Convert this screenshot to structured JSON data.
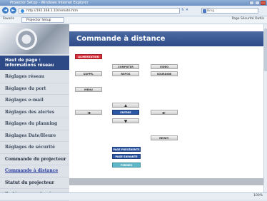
{
  "browser": {
    "title": "Projector Setup - Windows Internet Explorer",
    "address": "http://192.168.1.10/remote.htm",
    "search_placeholder": "Bing",
    "favorites_label": "Favoris",
    "tab_label": "Projector Setup",
    "tools_label": "Page  Sécurité  Outils",
    "status_zoom": "100%"
  },
  "sidebar": {
    "header": "Haut de page : Informations réseau",
    "items": [
      "Réglages réseau",
      "Réglages du port",
      "Réglages e-mail",
      "Réglages des alertes",
      "Réglages du planning",
      "Réglages Date/Heure",
      "Réglages de sécurité",
      "Commande du projecteur",
      "Commande à distance",
      "Statut du projecteur",
      "Redémarrage du réseau"
    ],
    "active_index": 8
  },
  "page": {
    "title": "Commande à distance"
  },
  "buttons": {
    "alimentation": "ALIMENTATION",
    "computer": "COMPUTER",
    "video": "VIDEO",
    "suppr": "SUPPR.",
    "repos": "REPOS",
    "sourdine": "SOURDINE",
    "menu": "MENU",
    "up": "▲",
    "left": "◄",
    "entree": "ENTREE",
    "right": "►",
    "down": "▼",
    "reinit": "REINIT.",
    "page_precedente": "PAGE PRÉCÉDENTE",
    "page_suivante": "PAGE SUIVANTE",
    "fermer": "FERMER"
  },
  "colors": {
    "header_blue": "#2e4b87",
    "power_red": "#d9313a",
    "enter_blue": "#2d58a6",
    "close_cyan": "#5fb8c8"
  }
}
